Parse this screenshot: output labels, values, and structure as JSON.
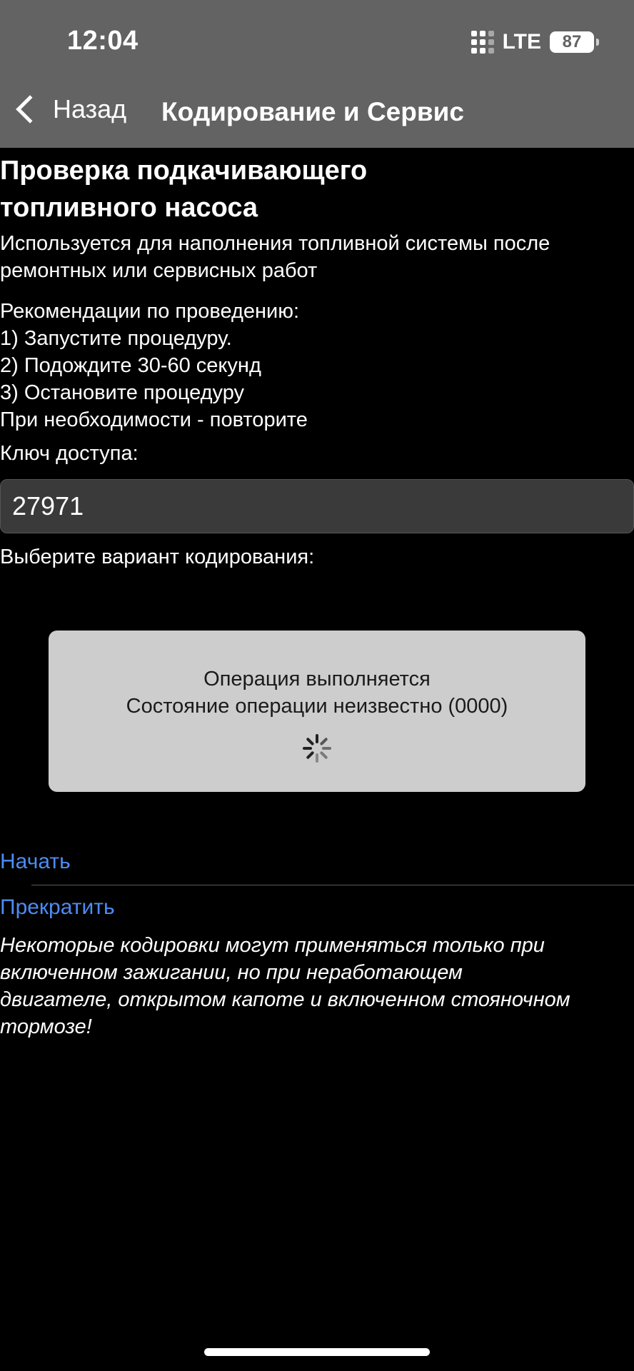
{
  "status_bar": {
    "time": "12:04",
    "network": "LTE",
    "battery": "87"
  },
  "nav": {
    "back_label": "Назад",
    "title": "Кодирование и Сервис"
  },
  "page": {
    "heading_line1": "Проверка подкачивающего",
    "heading_line2": "топливного насоса",
    "description_line1": "Используется для наполнения топливной системы после",
    "description_line2": "ремонтных или сервисных работ",
    "recommendations": [
      "Рекомендации по проведению:",
      "1) Запустите процедуру.",
      "2) Подождите 30-60 секунд",
      "3) Остановите процедуру",
      "При необходимости - повторите"
    ],
    "access_key_label": "Ключ доступа:",
    "access_key_value": "27971",
    "variant_label": "Выберите вариант кодирования:"
  },
  "progress_dialog": {
    "line1": "Операция выполняется",
    "line2": "Состояние операции неизвестно (0000)",
    "spinner_icon": "activity-spinner-icon"
  },
  "actions": {
    "start": "Начать",
    "stop": "Прекратить"
  },
  "note_lines": [
    "Некоторые кодировки могут применяться только при",
    "включенном зажигании, но при неработающем",
    "двигателе, открытом капоте и включенном стояночном",
    "тормозе!"
  ],
  "colors": {
    "nav_background": "#636363",
    "link": "#4c8cf3",
    "dialog_background": "#cdcdcd"
  }
}
